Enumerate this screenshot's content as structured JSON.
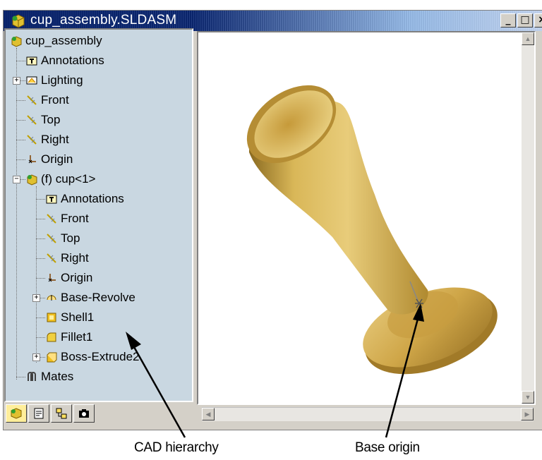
{
  "window": {
    "title": "cup_assembly.SLDASM",
    "controls": {
      "minimize": "_",
      "maximize": "□",
      "close": "×"
    }
  },
  "tree": {
    "root": "cup_assembly",
    "items": [
      {
        "label": "Annotations",
        "icon": "annotations-icon"
      },
      {
        "label": "Lighting",
        "icon": "lighting-icon",
        "expander": "+"
      },
      {
        "label": "Front",
        "icon": "plane-icon"
      },
      {
        "label": "Top",
        "icon": "plane-icon"
      },
      {
        "label": "Right",
        "icon": "plane-icon"
      },
      {
        "label": "Origin",
        "icon": "origin-icon"
      },
      {
        "label": "(f) cup<1>",
        "icon": "part-icon",
        "expander": "−"
      },
      {
        "label": "Annotations",
        "icon": "annotations-icon"
      },
      {
        "label": "Front",
        "icon": "plane-icon"
      },
      {
        "label": "Top",
        "icon": "plane-icon"
      },
      {
        "label": "Right",
        "icon": "plane-icon"
      },
      {
        "label": "Origin",
        "icon": "origin-icon"
      },
      {
        "label": "Base-Revolve",
        "icon": "revolve-icon",
        "expander": "+"
      },
      {
        "label": "Shell1",
        "icon": "shell-icon"
      },
      {
        "label": "Fillet1",
        "icon": "fillet-icon"
      },
      {
        "label": "Boss-Extrude2",
        "icon": "extrude-icon",
        "expander": "+"
      },
      {
        "label": "Mates",
        "icon": "mates-icon"
      }
    ]
  },
  "panel_tabs": [
    "feature-manager-tab",
    "property-manager-tab",
    "configuration-manager-tab",
    "photo-tab"
  ],
  "callouts": {
    "left": "CAD hierarchy",
    "right": "Base origin"
  },
  "colors": {
    "tree_bg": "#c9d7e1",
    "title_bar": "#0a246a",
    "cup_gold": "#d6b24e"
  }
}
